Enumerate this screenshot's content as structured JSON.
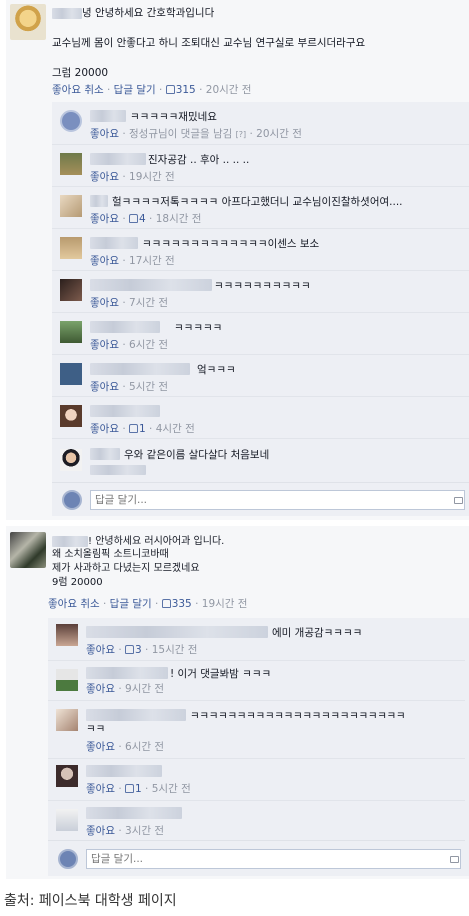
{
  "common": {
    "like_label": "좋아요",
    "unlike_label": "좋아요 취소",
    "reply_label": "답글 달기",
    "reply_placeholder": "답글 달기...",
    "separator": "·"
  },
  "posts": [
    {
      "author_suffix": "녕 안녕하세요 간호학과입니다",
      "lines": [
        "교수님께 몸이 안좋다고 하니 조퇴대신 교수님 연구실로 부르시더라구요",
        "",
        "그럼 20000"
      ],
      "like_count": "315",
      "time": "20시간 전",
      "comments": [
        {
          "text": "ㅋㅋㅋㅋㅋ재밌네요",
          "meta": "정성규님이 댓글을 남김",
          "extra": "[?]",
          "time": "20시간 전",
          "likes": ""
        },
        {
          "text": "진자공감 .. 후아 .. .. ..",
          "time": "19시간 전",
          "likes": ""
        },
        {
          "text": "헐ㅋㅋㅋㅋ저톡ㅋㅋㅋㅋ 아프다고했더니 교수님이진찰하셧어여....",
          "time": "18시간 전",
          "likes": "4"
        },
        {
          "text": "ㅋㅋㅋㅋㅋㅋㅋㅋㅋㅋㅋㅋㅋ이센스 보소",
          "time": "17시간 전",
          "likes": ""
        },
        {
          "text": "ㅋㅋㅋㅋㅋㅋㅋㅋㅋㅋ",
          "time": "7시간 전",
          "likes": ""
        },
        {
          "text": "ㅋㅋㅋㅋㅋ",
          "time": "6시간 전",
          "likes": ""
        },
        {
          "text": "엌ㅋㅋㅋ",
          "time": "5시간 전",
          "likes": ""
        },
        {
          "text": "",
          "time": "4시간 전",
          "likes": "1"
        },
        {
          "text": "우와 같은이름 살다살다 처음보네",
          "time": "",
          "likes": ""
        }
      ]
    },
    {
      "author_suffix": "! 안녕하세요 러시아어과 입니다.",
      "lines": [
        "왜 소치올림픽 소트니코바때",
        "제가 사과하고 다녔는지 모르겠네요",
        "9럼 20000"
      ],
      "like_count": "335",
      "time": "19시간 전",
      "comments": [
        {
          "text": "에미 개공감ㅋㅋㅋㅋ",
          "time": "15시간 전",
          "likes": "3"
        },
        {
          "text": "! 이거 댓글봐밤 ㅋㅋㅋ",
          "time": "9시간 전",
          "likes": ""
        },
        {
          "text": "ㅋㅋㅋㅋㅋㅋㅋㅋㅋㅋㅋㅋㅋㅋㅋㅋㅋㅋㅋㅋㅋㅋㅋ",
          "text2": "ㅋㅋ",
          "time": "6시간 전",
          "likes": ""
        },
        {
          "text": "",
          "time": "5시간 전",
          "likes": "1"
        },
        {
          "text": "",
          "time": "3시간 전",
          "likes": ""
        }
      ]
    }
  ],
  "source_caption": "출처: 페이스북 대학생 페이지"
}
